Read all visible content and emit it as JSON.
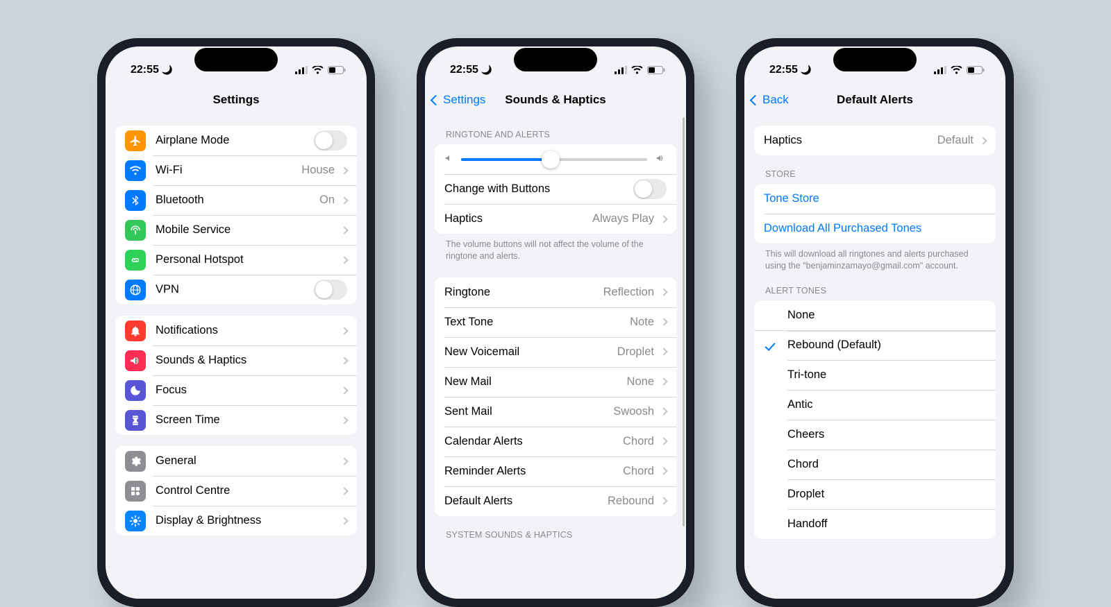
{
  "status": {
    "time": "22:55"
  },
  "phone1": {
    "title": "Settings",
    "network": {
      "airplane": "Airplane Mode",
      "wifi": {
        "label": "Wi-Fi",
        "value": "House"
      },
      "bluetooth": {
        "label": "Bluetooth",
        "value": "On"
      },
      "mobile": "Mobile Service",
      "hotspot": "Personal Hotspot",
      "vpn": "VPN"
    },
    "alerts": {
      "notifications": "Notifications",
      "sounds": "Sounds & Haptics",
      "focus": "Focus",
      "screentime": "Screen Time"
    },
    "system": {
      "general": "General",
      "control": "Control Centre",
      "display": "Display & Brightness"
    }
  },
  "phone2": {
    "back": "Settings",
    "title": "Sounds & Haptics",
    "sec1": {
      "header": "RINGTONE AND ALERTS",
      "changeButtons": "Change with Buttons",
      "haptics": {
        "label": "Haptics",
        "value": "Always Play"
      },
      "footer": "The volume buttons will not affect the volume of the ringtone and alerts."
    },
    "tones": {
      "ringtone": {
        "label": "Ringtone",
        "value": "Reflection"
      },
      "text": {
        "label": "Text Tone",
        "value": "Note"
      },
      "voicemail": {
        "label": "New Voicemail",
        "value": "Droplet"
      },
      "newmail": {
        "label": "New Mail",
        "value": "None"
      },
      "sentmail": {
        "label": "Sent Mail",
        "value": "Swoosh"
      },
      "calendar": {
        "label": "Calendar Alerts",
        "value": "Chord"
      },
      "reminder": {
        "label": "Reminder Alerts",
        "value": "Chord"
      },
      "default": {
        "label": "Default Alerts",
        "value": "Rebound"
      }
    },
    "sec3": {
      "header": "SYSTEM SOUNDS & HAPTICS"
    }
  },
  "phone3": {
    "back": "Back",
    "title": "Default Alerts",
    "haptics": {
      "label": "Haptics",
      "value": "Default"
    },
    "store": {
      "header": "STORE",
      "toneStore": "Tone Store",
      "download": "Download All Purchased Tones",
      "footer": "This will download all ringtones and alerts purchased using the \"benjaminzamayo@gmail.com\" account."
    },
    "alertTones": {
      "header": "ALERT TONES",
      "none": "None",
      "items": {
        "rebound": "Rebound (Default)",
        "tritone": "Tri-tone",
        "antic": "Antic",
        "cheers": "Cheers",
        "chord": "Chord",
        "droplet": "Droplet",
        "handoff": "Handoff"
      }
    }
  }
}
